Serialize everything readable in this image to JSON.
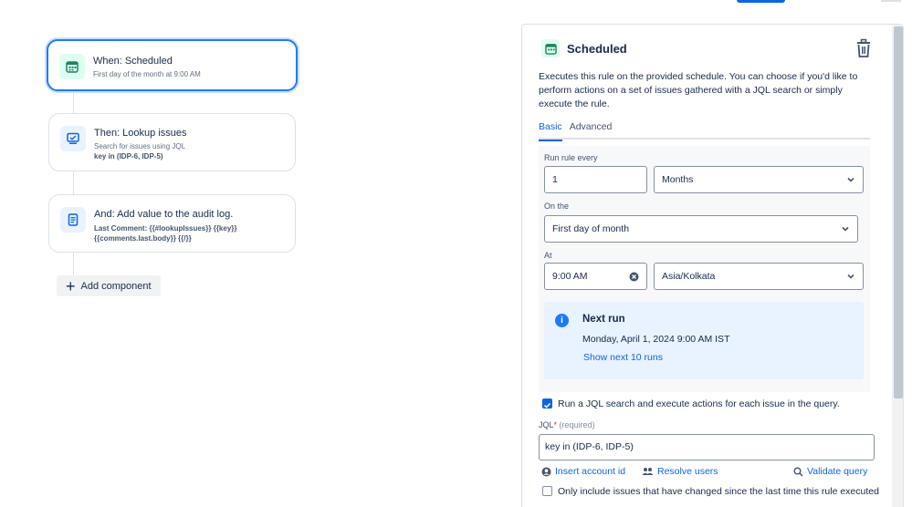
{
  "rule_canvas": {
    "trigger": {
      "title": "When: Scheduled",
      "subtitle": "First day of the month at 9:00 AM",
      "icon": "calendar-icon"
    },
    "action_lookup": {
      "title": "Then: Lookup issues",
      "subtitle": "Search for issues using JQL",
      "detail": "key in (IDP-6, IDP-5)",
      "icon": "monitor-icon"
    },
    "action_audit": {
      "title": "And: Add value to the audit log.",
      "detail_line1": "Last Comment: {{#lookupIssues}} {{key}}",
      "detail_line2": "{{comments.last.body}} {{/}}",
      "icon": "document-icon"
    },
    "add_component_label": "Add component"
  },
  "panel": {
    "title": "Scheduled",
    "description": "Executes this rule on the provided schedule. You can choose if you'd like to perform actions on a set of issues gathered with a JQL search or simply execute the rule.",
    "tabs": [
      "Basic",
      "Advanced"
    ],
    "active_tab": "Basic",
    "run_rule_every": {
      "label": "Run rule every",
      "value": "1",
      "unit": "Months"
    },
    "on_the": {
      "label": "On the",
      "value": "First day of month"
    },
    "at": {
      "label": "At",
      "time": "9:00 AM",
      "timezone": "Asia/Kolkata"
    },
    "next_run": {
      "title": "Next run",
      "date": "Monday, April 1, 2024 9:00 AM IST",
      "link": "Show next 10 runs"
    },
    "jql_search_checkbox": {
      "label": "Run a JQL search and execute actions for each issue in the query.",
      "checked": true
    },
    "jql": {
      "label": "JQL",
      "required_mark": "*",
      "required_text": "(required)",
      "value": "key in (IDP-6, IDP-5)"
    },
    "actions": {
      "insert_account_id": "Insert account id",
      "resolve_users": "Resolve users",
      "validate_query": "Validate query"
    },
    "changed_only_checkbox": {
      "label": "Only include issues that have changed since the last time this rule executed",
      "checked": false
    }
  },
  "colors": {
    "accent": "#0c66e4",
    "selected_border": "#1d7afc",
    "success_bg": "#dcfff1",
    "info_bg": "#e9f2ff"
  }
}
